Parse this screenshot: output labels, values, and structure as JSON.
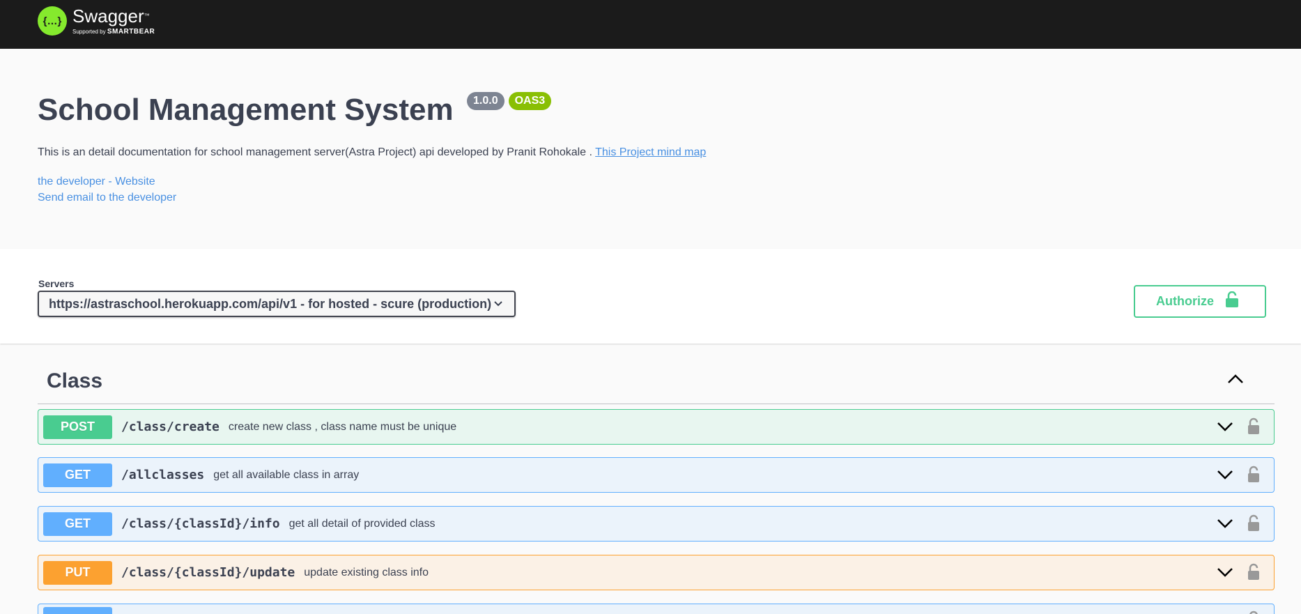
{
  "topbar": {
    "logo_title": "Swagger",
    "logo_tm": "™",
    "logo_supported": "Supported by",
    "logo_brand": "SMARTBEAR",
    "logo_symbol": "{…}"
  },
  "info": {
    "title": "School Management System",
    "version": "1.0.0",
    "oas": "OAS3",
    "description": "This is an detail documentation for school management server(Astra Project) api developed by Pranit Rohokale .",
    "mindmap_link": "This Project mind map",
    "contact_developer": "the developer",
    "contact_separator": " - ",
    "contact_website": "Website",
    "contact_email": "Send email to the developer"
  },
  "scheme": {
    "servers_label": "Servers",
    "selected_server": "https://astraschool.herokuapp.com/api/v1 - for hosted - scure (production)",
    "authorize_label": "Authorize"
  },
  "tag": {
    "name": "Class"
  },
  "operations": [
    {
      "method": "POST",
      "path": "/class/create",
      "summary": "create new class , class name must be unique"
    },
    {
      "method": "GET",
      "path": "/allclasses",
      "summary": "get all available class in array"
    },
    {
      "method": "GET",
      "path": "/class/{classId}/info",
      "summary": "get all detail of provided class"
    },
    {
      "method": "PUT",
      "path": "/class/{classId}/update",
      "summary": "update existing class info"
    }
  ],
  "colors": {
    "post": "#49cc90",
    "get": "#61affe",
    "put": "#fca130",
    "link": "#4990e2",
    "topbar": "#1b1b1b",
    "logo": "#85ea2d"
  }
}
